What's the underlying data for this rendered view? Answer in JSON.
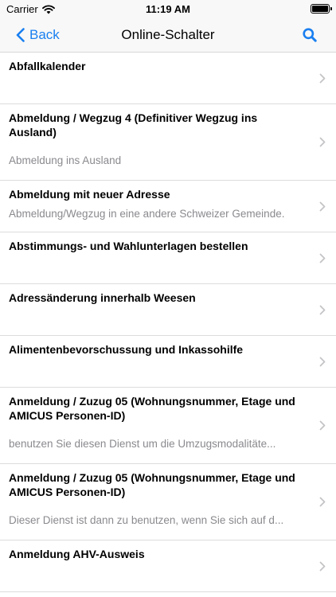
{
  "status_bar": {
    "carrier": "Carrier",
    "time": "11:19 AM",
    "wifi_icon": "wifi-icon",
    "battery_icon": "battery-icon"
  },
  "nav": {
    "back_label": "Back",
    "title": "Online-Schalter",
    "search_icon": "search-icon",
    "accent_color": "#1a7ff0"
  },
  "rows": [
    {
      "title": "Abfallkalender",
      "subtitle": ""
    },
    {
      "title": "Abmeldung / Wegzug 4 (Definitiver Wegzug ins Ausland)",
      "subtitle": "Abmeldung ins Ausland"
    },
    {
      "title": "Abmeldung mit neuer Adresse",
      "subtitle": "Abmeldung/Wegzug in eine andere Schweizer Gemeinde."
    },
    {
      "title": "Abstimmungs- und Wahlunterlagen bestellen",
      "subtitle": ""
    },
    {
      "title": "Adressänderung innerhalb Weesen",
      "subtitle": ""
    },
    {
      "title": "Alimentenbevorschussung und Inkassohilfe",
      "subtitle": ""
    },
    {
      "title": "Anmeldung / Zuzug 05 (Wohnungsnummer, Etage und AMICUS Personen-ID)",
      "subtitle": "benutzen Sie diesen Dienst um die Umzugsmodalitäte..."
    },
    {
      "title": "Anmeldung / Zuzug 05 (Wohnungsnummer, Etage und AMICUS Personen-ID)",
      "subtitle": "Dieser Dienst ist dann zu benutzen, wenn Sie sich auf d..."
    },
    {
      "title": "Anmeldung AHV-Ausweis",
      "subtitle": ""
    }
  ]
}
